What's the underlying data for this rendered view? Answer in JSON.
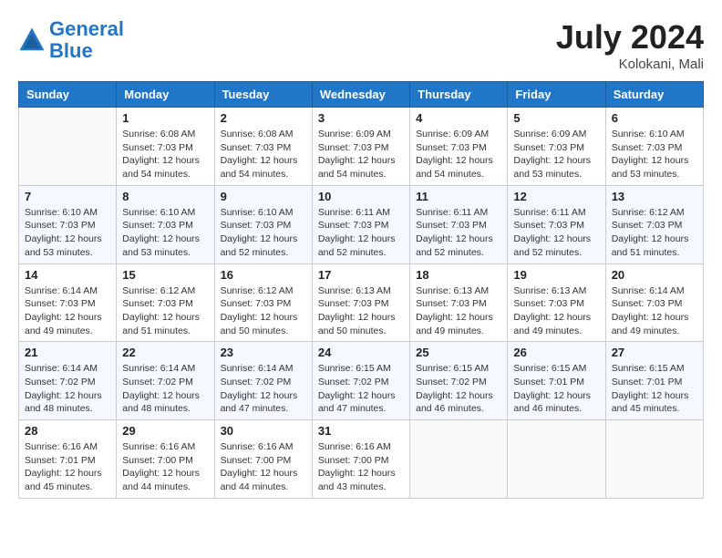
{
  "header": {
    "logo_line1": "General",
    "logo_line2": "Blue",
    "month_title": "July 2024",
    "location": "Kolokani, Mali"
  },
  "days_of_week": [
    "Sunday",
    "Monday",
    "Tuesday",
    "Wednesday",
    "Thursday",
    "Friday",
    "Saturday"
  ],
  "weeks": [
    [
      {
        "day": "",
        "info": ""
      },
      {
        "day": "1",
        "info": "Sunrise: 6:08 AM\nSunset: 7:03 PM\nDaylight: 12 hours\nand 54 minutes."
      },
      {
        "day": "2",
        "info": "Sunrise: 6:08 AM\nSunset: 7:03 PM\nDaylight: 12 hours\nand 54 minutes."
      },
      {
        "day": "3",
        "info": "Sunrise: 6:09 AM\nSunset: 7:03 PM\nDaylight: 12 hours\nand 54 minutes."
      },
      {
        "day": "4",
        "info": "Sunrise: 6:09 AM\nSunset: 7:03 PM\nDaylight: 12 hours\nand 54 minutes."
      },
      {
        "day": "5",
        "info": "Sunrise: 6:09 AM\nSunset: 7:03 PM\nDaylight: 12 hours\nand 53 minutes."
      },
      {
        "day": "6",
        "info": "Sunrise: 6:10 AM\nSunset: 7:03 PM\nDaylight: 12 hours\nand 53 minutes."
      }
    ],
    [
      {
        "day": "7",
        "info": ""
      },
      {
        "day": "8",
        "info": "Sunrise: 6:10 AM\nSunset: 7:03 PM\nDaylight: 12 hours\nand 53 minutes."
      },
      {
        "day": "9",
        "info": "Sunrise: 6:10 AM\nSunset: 7:03 PM\nDaylight: 12 hours\nand 52 minutes."
      },
      {
        "day": "10",
        "info": "Sunrise: 6:11 AM\nSunset: 7:03 PM\nDaylight: 12 hours\nand 52 minutes."
      },
      {
        "day": "11",
        "info": "Sunrise: 6:11 AM\nSunset: 7:03 PM\nDaylight: 12 hours\nand 52 minutes."
      },
      {
        "day": "12",
        "info": "Sunrise: 6:11 AM\nSunset: 7:03 PM\nDaylight: 12 hours\nand 52 minutes."
      },
      {
        "day": "13",
        "info": "Sunrise: 6:12 AM\nSunset: 7:03 PM\nDaylight: 12 hours\nand 51 minutes."
      }
    ],
    [
      {
        "day": "14",
        "info": ""
      },
      {
        "day": "15",
        "info": "Sunrise: 6:12 AM\nSunset: 7:03 PM\nDaylight: 12 hours\nand 51 minutes."
      },
      {
        "day": "16",
        "info": "Sunrise: 6:12 AM\nSunset: 7:03 PM\nDaylight: 12 hours\nand 50 minutes."
      },
      {
        "day": "17",
        "info": "Sunrise: 6:13 AM\nSunset: 7:03 PM\nDaylight: 12 hours\nand 50 minutes."
      },
      {
        "day": "18",
        "info": "Sunrise: 6:13 AM\nSunset: 7:03 PM\nDaylight: 12 hours\nand 49 minutes."
      },
      {
        "day": "19",
        "info": "Sunrise: 6:13 AM\nSunset: 7:03 PM\nDaylight: 12 hours\nand 49 minutes."
      },
      {
        "day": "20",
        "info": "Sunrise: 6:14 AM\nSunset: 7:03 PM\nDaylight: 12 hours\nand 49 minutes."
      }
    ],
    [
      {
        "day": "21",
        "info": ""
      },
      {
        "day": "22",
        "info": "Sunrise: 6:14 AM\nSunset: 7:02 PM\nDaylight: 12 hours\nand 48 minutes."
      },
      {
        "day": "23",
        "info": "Sunrise: 6:14 AM\nSunset: 7:02 PM\nDaylight: 12 hours\nand 47 minutes."
      },
      {
        "day": "24",
        "info": "Sunrise: 6:15 AM\nSunset: 7:02 PM\nDaylight: 12 hours\nand 47 minutes."
      },
      {
        "day": "25",
        "info": "Sunrise: 6:15 AM\nSunset: 7:02 PM\nDaylight: 12 hours\nand 46 minutes."
      },
      {
        "day": "26",
        "info": "Sunrise: 6:15 AM\nSunset: 7:01 PM\nDaylight: 12 hours\nand 46 minutes."
      },
      {
        "day": "27",
        "info": "Sunrise: 6:15 AM\nSunset: 7:01 PM\nDaylight: 12 hours\nand 45 minutes."
      }
    ],
    [
      {
        "day": "28",
        "info": "Sunrise: 6:16 AM\nSunset: 7:01 PM\nDaylight: 12 hours\nand 45 minutes."
      },
      {
        "day": "29",
        "info": "Sunrise: 6:16 AM\nSunset: 7:00 PM\nDaylight: 12 hours\nand 44 minutes."
      },
      {
        "day": "30",
        "info": "Sunrise: 6:16 AM\nSunset: 7:00 PM\nDaylight: 12 hours\nand 44 minutes."
      },
      {
        "day": "31",
        "info": "Sunrise: 6:16 AM\nSunset: 7:00 PM\nDaylight: 12 hours\nand 43 minutes."
      },
      {
        "day": "",
        "info": ""
      },
      {
        "day": "",
        "info": ""
      },
      {
        "day": "",
        "info": ""
      }
    ]
  ],
  "week1_sunday_info": "Sunrise: 6:10 AM\nSunset: 7:03 PM\nDaylight: 12 hours\nand 53 minutes.",
  "week3_sunday_info": "Sunrise: 6:14 AM\nSunset: 7:03 PM\nDaylight: 12 hours\nand 49 minutes.",
  "week4_sunday_info": "Sunrise: 6:14 AM\nSunset: 7:02 PM\nDaylight: 12 hours\nand 48 minutes."
}
